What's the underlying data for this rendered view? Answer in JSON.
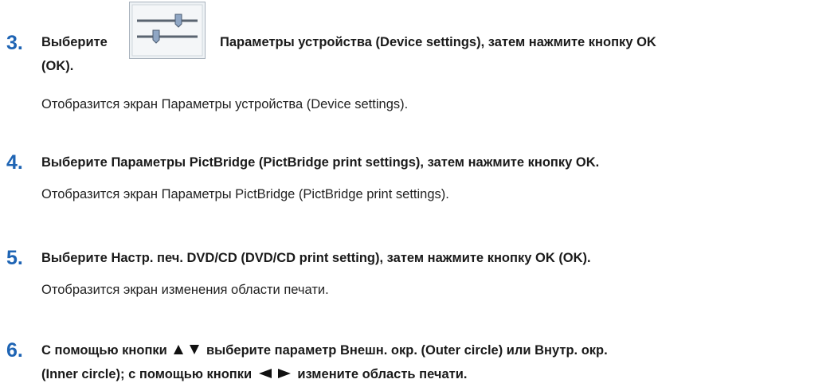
{
  "steps": [
    {
      "number": "3.",
      "title_before_icon": "Выберите",
      "icon": "device-settings-icon",
      "title_after_icon": "Параметры устройства (Device settings), затем нажмите кнопку OK",
      "title_line2": "(OK).",
      "description": "Отобразится экран Параметры устройства (Device settings)."
    },
    {
      "number": "4.",
      "title": "Выберите Параметры PictBridge (PictBridge print settings), затем нажмите кнопку OK.",
      "description": "Отобразится экран Параметры PictBridge (PictBridge print settings)."
    },
    {
      "number": "5.",
      "title": "Выберите Настр. печ. DVD/CD (DVD/CD print setting), затем нажмите кнопку OK (OK).",
      "description": "Отобразится экран изменения области печати."
    },
    {
      "number": "6.",
      "title_part1": "С помощью кнопки",
      "title_part2": "выберите параметр Внешн. окр. (Outer circle) или Внутр. окр.",
      "title_line2_part1": "(Inner circle); с помощью кнопки",
      "title_line2_part2": "измените область печати.",
      "icons": [
        "up-arrow-icon",
        "down-arrow-icon",
        "left-arrow-icon",
        "right-arrow-icon"
      ]
    }
  ],
  "colors": {
    "step_number": "#1e64b4",
    "icon_border": "#a9b3bd"
  }
}
